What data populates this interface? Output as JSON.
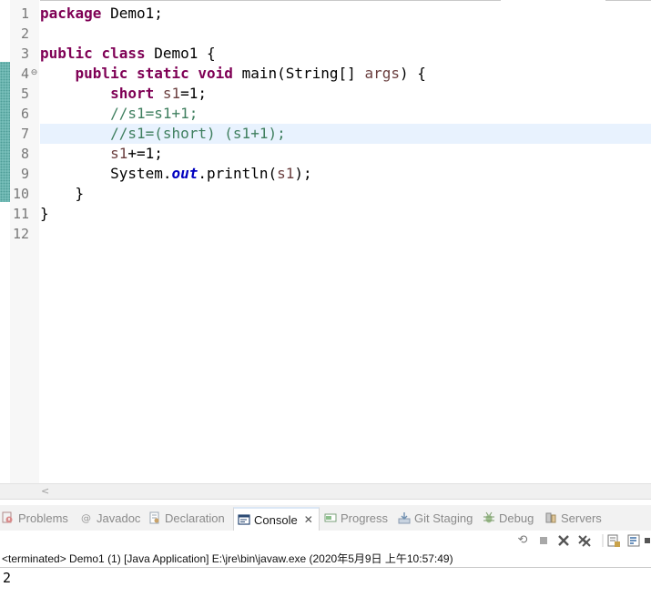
{
  "editor": {
    "lines": [
      {
        "num": "1",
        "segments": [
          {
            "cls": "kw",
            "t": "package"
          },
          {
            "cls": "",
            "t": " Demo1;"
          }
        ]
      },
      {
        "num": "2",
        "segments": []
      },
      {
        "num": "3",
        "segments": [
          {
            "cls": "kw",
            "t": "public"
          },
          {
            "cls": "",
            "t": " "
          },
          {
            "cls": "kw",
            "t": "class"
          },
          {
            "cls": "",
            "t": " Demo1 {"
          }
        ]
      },
      {
        "num": "4",
        "fold": "⊖",
        "segments": [
          {
            "cls": "",
            "t": "    "
          },
          {
            "cls": "kw",
            "t": "public"
          },
          {
            "cls": "",
            "t": " "
          },
          {
            "cls": "kw",
            "t": "static"
          },
          {
            "cls": "",
            "t": " "
          },
          {
            "cls": "kw",
            "t": "void"
          },
          {
            "cls": "",
            "t": " main(String[] "
          },
          {
            "cls": "var",
            "t": "args"
          },
          {
            "cls": "",
            "t": ") {"
          }
        ]
      },
      {
        "num": "5",
        "segments": [
          {
            "cls": "",
            "t": "        "
          },
          {
            "cls": "kw",
            "t": "short"
          },
          {
            "cls": "",
            "t": " "
          },
          {
            "cls": "var",
            "t": "s1"
          },
          {
            "cls": "",
            "t": "=1;"
          }
        ]
      },
      {
        "num": "6",
        "segments": [
          {
            "cls": "",
            "t": "        "
          },
          {
            "cls": "cm",
            "t": "//s1=s1+1;"
          }
        ]
      },
      {
        "num": "7",
        "current": true,
        "segments": [
          {
            "cls": "",
            "t": "        "
          },
          {
            "cls": "cm",
            "t": "//s1=(short) (s1+1);"
          }
        ]
      },
      {
        "num": "8",
        "segments": [
          {
            "cls": "",
            "t": "        "
          },
          {
            "cls": "var",
            "t": "s1"
          },
          {
            "cls": "",
            "t": "+=1;"
          }
        ]
      },
      {
        "num": "9",
        "segments": [
          {
            "cls": "",
            "t": "        System."
          },
          {
            "cls": "fld",
            "t": "out"
          },
          {
            "cls": "",
            "t": ".println("
          },
          {
            "cls": "var",
            "t": "s1"
          },
          {
            "cls": "",
            "t": ");"
          }
        ]
      },
      {
        "num": "10",
        "segments": [
          {
            "cls": "",
            "t": "    }"
          }
        ]
      },
      {
        "num": "11",
        "segments": [
          {
            "cls": "",
            "t": "}"
          }
        ]
      },
      {
        "num": "12",
        "segments": []
      }
    ],
    "scroll_left_glyph": "<"
  },
  "tabs": [
    {
      "id": "problems",
      "label": "Problems",
      "icon": "problems-icon"
    },
    {
      "id": "javadoc",
      "label": "Javadoc",
      "icon": "at-icon"
    },
    {
      "id": "declaration",
      "label": "Declaration",
      "icon": "declaration-icon"
    },
    {
      "id": "console",
      "label": "Console",
      "icon": "console-icon",
      "active": true,
      "close": "✕"
    },
    {
      "id": "progress",
      "label": "Progress",
      "icon": "progress-icon"
    },
    {
      "id": "git-staging",
      "label": "Git Staging",
      "icon": "git-staging-icon"
    },
    {
      "id": "debug",
      "label": "Debug",
      "icon": "bug-icon"
    },
    {
      "id": "servers",
      "label": "Servers",
      "icon": "servers-icon"
    }
  ],
  "console": {
    "status": "<terminated> Demo1 (1) [Java Application] E:\\jre\\bin\\javaw.exe (2020年5月9日 上午10:57:49)",
    "output": "2"
  },
  "colors": {
    "keyword": "#7f0055",
    "comment": "#3f7f5f",
    "variable": "#6a3e3e",
    "field": "#0000c0",
    "current_line": "#e8f2fe"
  }
}
